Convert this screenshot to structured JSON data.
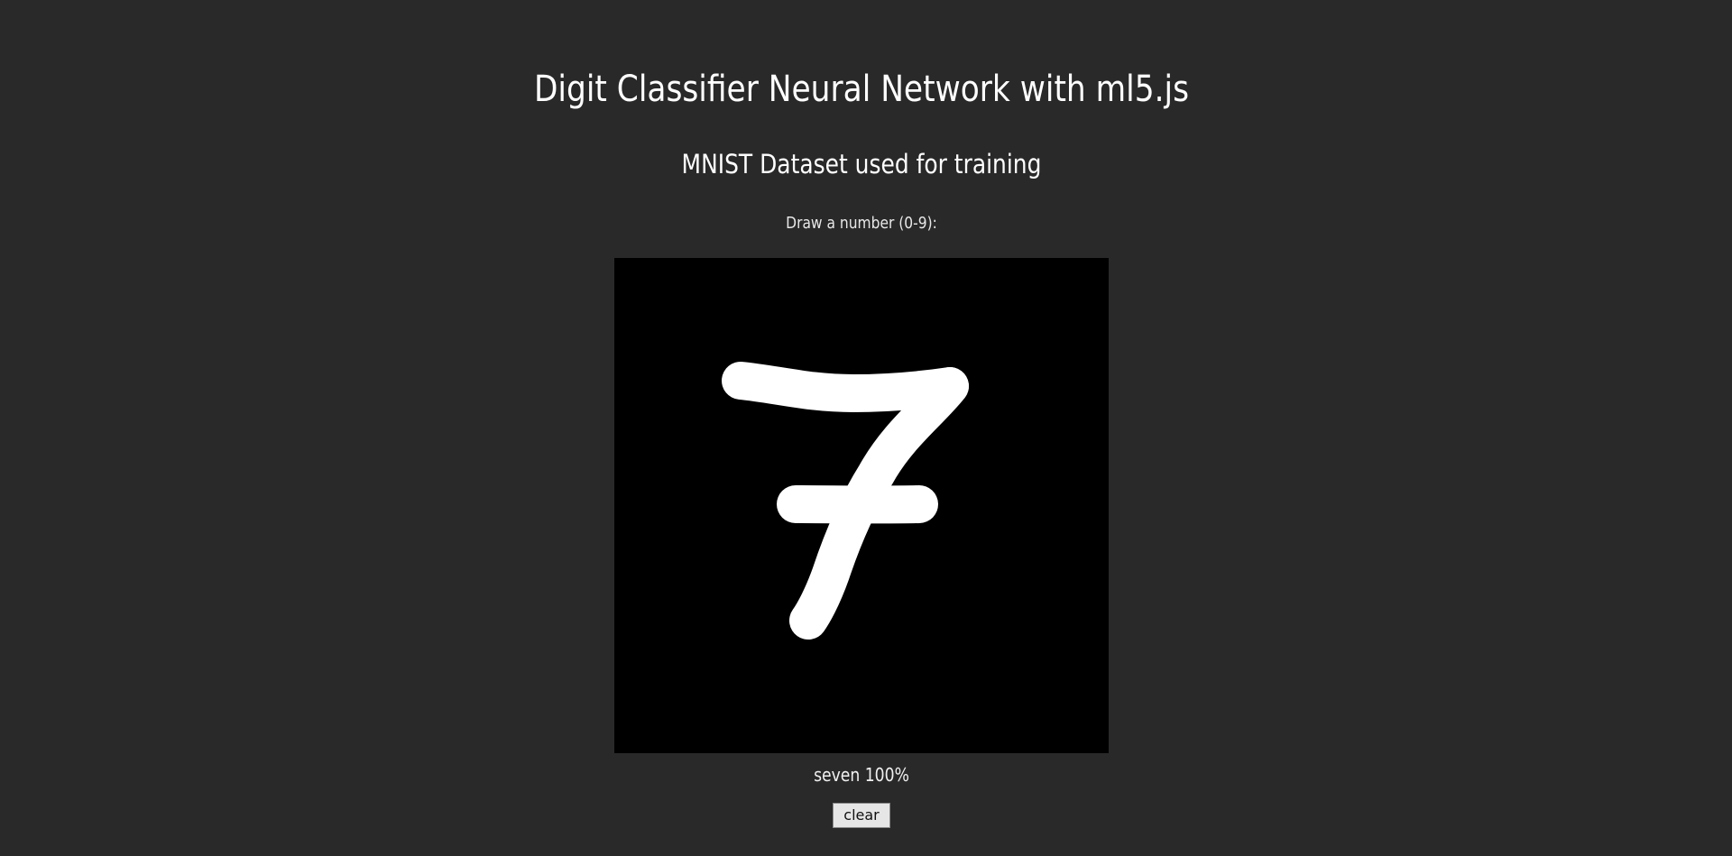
{
  "page": {
    "title": "Digit Classifier Neural Network with ml5.js",
    "subtitle": "MNIST Dataset used for training",
    "prompt": "Draw a number (0-9):"
  },
  "canvas": {
    "background": "#000000",
    "stroke_color": "#ffffff",
    "drawn_digit": "7"
  },
  "result": {
    "label": "seven 100%"
  },
  "controls": {
    "clear_label": "clear"
  }
}
